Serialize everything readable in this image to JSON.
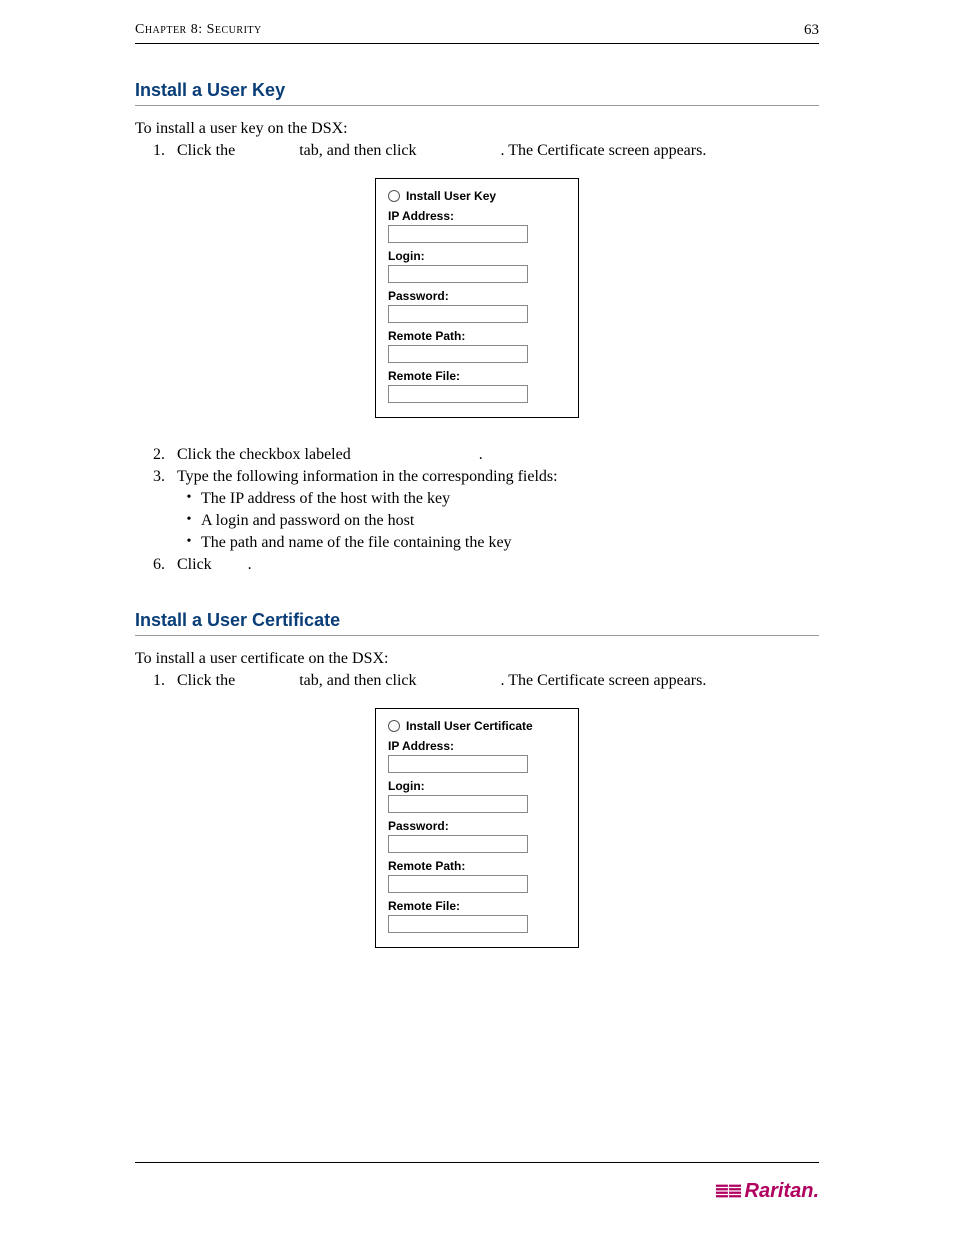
{
  "header": {
    "chapter": "Chapter 8: Security",
    "page_number": "63"
  },
  "section1": {
    "heading": "Install a User Key",
    "intro": "To install a user key on the DSX:",
    "step1_a": "Click the ",
    "step1_b": " tab, and then click ",
    "step1_c": ". The Certificate screen appears.",
    "step2": "Click the checkbox labeled ",
    "step2_end": ".",
    "step3": "Type the following information in the corresponding fields:",
    "bullet1": "The IP address of the host with the key",
    "bullet2": "A login and password on the host",
    "bullet3": "The path and name of the file containing the key",
    "step6": "Click ",
    "step6_end": "."
  },
  "panel1": {
    "radio_label": "Install User Key",
    "ip": "IP Address:",
    "login": "Login:",
    "password": "Password:",
    "remote_path": "Remote Path:",
    "remote_file": "Remote File:"
  },
  "section2": {
    "heading": "Install a User Certificate",
    "intro": "To install a user certificate on the DSX:",
    "step1_a": "Click the ",
    "step1_b": " tab, and then click ",
    "step1_c": ". The Certificate screen appears."
  },
  "panel2": {
    "radio_label": "Install User Certificate",
    "ip": "IP Address:",
    "login": "Login:",
    "password": "Password:",
    "remote_path": "Remote Path:",
    "remote_file": "Remote File:"
  },
  "footer": {
    "brand": "Raritan."
  }
}
